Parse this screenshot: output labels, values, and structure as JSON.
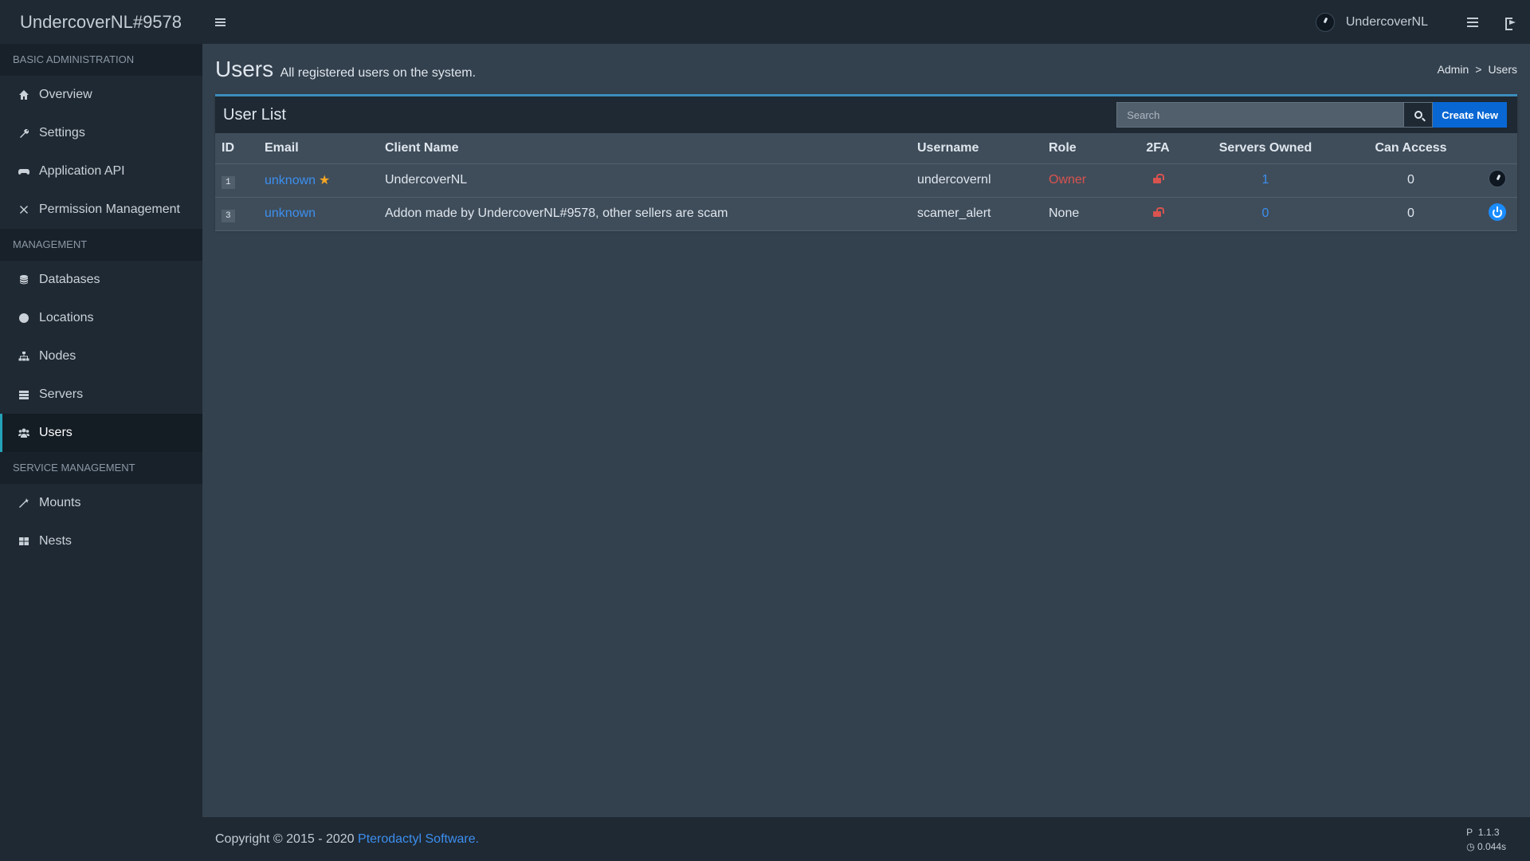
{
  "app": {
    "brand": "UndercoverNL#9578"
  },
  "topbar": {
    "username": "UndercoverNL"
  },
  "sidebar": {
    "sections": [
      {
        "header": "BASIC ADMINISTRATION",
        "items": [
          "Overview",
          "Settings",
          "Application API",
          "Permission Management"
        ]
      },
      {
        "header": "MANAGEMENT",
        "items": [
          "Databases",
          "Locations",
          "Nodes",
          "Servers",
          "Users"
        ]
      },
      {
        "header": "SERVICE MANAGEMENT",
        "items": [
          "Mounts",
          "Nests"
        ]
      }
    ],
    "active": "Users"
  },
  "page": {
    "title": "Users",
    "subtitle": "All registered users on the system."
  },
  "breadcrumb": {
    "items": [
      "Admin",
      "Users"
    ],
    "separator": ">"
  },
  "box": {
    "title": "User List",
    "search_placeholder": "Search",
    "create_label": "Create New"
  },
  "table": {
    "columns": [
      "ID",
      "Email",
      "Client Name",
      "Username",
      "Role",
      "2FA",
      "Servers Owned",
      "Can Access"
    ],
    "rows": [
      {
        "id": "1",
        "email": "unknown",
        "client_name": "UndercoverNL",
        "username": "undercovernl",
        "role": "Owner",
        "servers_owned": "1",
        "can_access": "0"
      },
      {
        "id": "3",
        "email": "unknown",
        "client_name": "Addon made by UndercoverNL#9578, other sellers are scam",
        "username": "scamer_alert",
        "role": "None",
        "servers_owned": "0",
        "can_access": "0"
      }
    ]
  },
  "footer": {
    "copyright": "Copyright © 2015 - 2020 ",
    "company": "Pterodactyl Software.",
    "version": "1.1.3",
    "time": "0.044s"
  },
  "colors": {
    "accent": "#3c8dbc",
    "primary_button": "#0967d3",
    "link": "#3c8ff0",
    "danger": "#d9534f",
    "active_border": "#25a2b8"
  }
}
